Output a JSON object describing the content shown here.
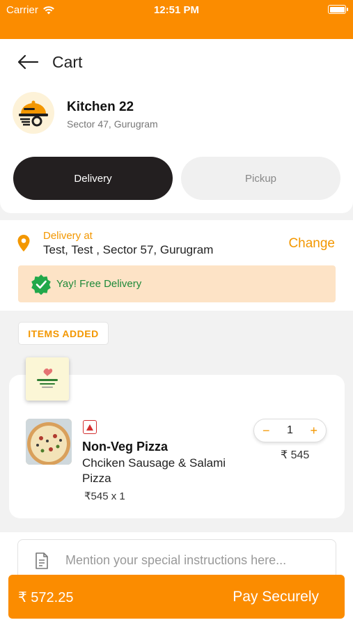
{
  "status_bar": {
    "carrier": "Carrier",
    "time": "12:51 PM"
  },
  "nav": {
    "title": "Cart"
  },
  "restaurant": {
    "name": "Kitchen 22",
    "location": "Sector 47, Gurugram"
  },
  "order_mode": {
    "options": [
      "Delivery",
      "Pickup"
    ],
    "selected": "Delivery"
  },
  "address": {
    "label": "Delivery at",
    "value": "Test, Test , Sector 57, Gurugram",
    "change_label": "Change"
  },
  "free_delivery": {
    "text": "Yay! Free Delivery"
  },
  "items_section": {
    "label": "ITEMS ADDED"
  },
  "items": [
    {
      "name": "Non-Veg Pizza",
      "description": "Chciken Sausage & Salami Pizza",
      "qty_price": "₹545 x 1",
      "quantity": "1",
      "price": "₹ 545",
      "decrement": "−",
      "increment": "+"
    }
  ],
  "notes": {
    "placeholder": "Mention your special instructions here..."
  },
  "pay_bar": {
    "amount": "₹ 572.25",
    "label": "Pay Securely"
  },
  "colors": {
    "accent": "#fb8c00",
    "accent_text": "#f39700",
    "dark": "#231f20",
    "success": "#1f8a3a",
    "banner_bg": "#fde3c6"
  }
}
